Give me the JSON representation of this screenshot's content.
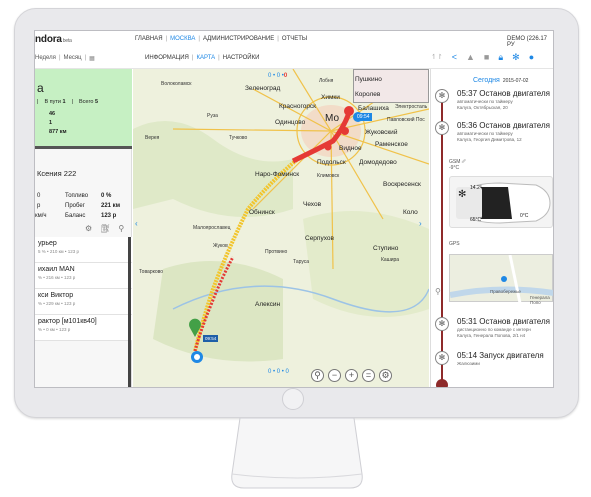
{
  "header": {
    "logo": "ndora",
    "logo_suffix": "beta",
    "nav": [
      "ГЛАВНАЯ",
      "МОСКВА",
      "АДМИНИСТРИРОВАНИЕ",
      "ОТЧЕТЫ"
    ],
    "nav_active_index": 1,
    "account": "DEMO (226.17 РУ",
    "period": [
      "Неделя",
      "Месяц"
    ],
    "subnav": [
      "ИНФОРМАЦИЯ",
      "КАРТА",
      "НАСТРОЙКИ"
    ],
    "subnav_active_index": 1
  },
  "left": {
    "big_title": "а",
    "in_way_label": "В пути",
    "in_way_value": "1",
    "total_label": "Всего",
    "total_value": "5",
    "v1": "46",
    "v2": "1",
    "v3": "877 км",
    "vehicle_name": "Ксения 222",
    "fuel_label": "Топливо",
    "fuel_value": "0 %",
    "mileage_label": "Пробег",
    "mileage_value": "221 км",
    "speed_label": "км/ч",
    "balance_label": "Баланс",
    "balance_value": "123 р",
    "speed_value": "0",
    "list": [
      {
        "name": "урьер",
        "meta": "5 % • 210 км • 123 р"
      },
      {
        "name": "ихаил MAN",
        "meta": "% • 216 км • 123 р"
      },
      {
        "name": "кси Виктор",
        "meta": "% • 229 км • 123 р"
      },
      {
        "name": "рактор [м101кв40]",
        "meta": "% • 0 км • 123 р"
      }
    ]
  },
  "map": {
    "counter": "0 • 0 •",
    "counter_red": "0",
    "counter_bottom": "0 • 0 • 0",
    "labels": {
      "zelenograd": "Зеленоград",
      "lobnya": "Лобня",
      "pushkino": "Пушкино",
      "khimki": "Химки",
      "korolev": "Королев",
      "krasnogorsk": "Красногорск",
      "balashikha": "Балашиха",
      "elektrostal": "Электросталь",
      "moskva": "Мо",
      "odintsovo": "Одинцово",
      "pavlposad": "Павловский Пос",
      "zhukovsky": "Жуковский",
      "ramenskoe": "Раменское",
      "vidnoe": "Видное",
      "podolsk": "Подольск",
      "domodedovo": "Домодедово",
      "klimovsk": "Климовск",
      "naro": "Наро-Фоминск",
      "voskresensk": "Воскресенск",
      "obninsk": "Обнинск",
      "chekhov": "Чехов",
      "serpukhov": "Серпухов",
      "stupino": "Ступино",
      "kolo": "Коло",
      "aleksin": "Алексин",
      "volokolamsk": "Волоколамск",
      "ruza": "Руза",
      "tuchkovo": "Тучково",
      "vereya": "Верея",
      "tarusa": "Таруса",
      "kashira": "Кашира",
      "protvino": "Протвино",
      "zhukov": "Жуков",
      "tovarkovo": "Товарково",
      "maloyaroslavets": "Малоярославец"
    },
    "marker_time": "09:54",
    "marker_time2": "09:54",
    "controls": [
      "pin-icon",
      "minus-icon",
      "plus-icon",
      "layers-icon",
      "settings-icon"
    ]
  },
  "right": {
    "today_label": "Сегодня",
    "today_date": "2015-07-02",
    "events": [
      {
        "time": "05:37 Останов двигателя",
        "sub1": "автоматически по таймеру",
        "sub2": "Калуга, Октябрьская, 20"
      },
      {
        "time": "05:36 Останов двигателя",
        "sub1": "автоматически по таймеру",
        "sub2": "Калуга, Георгия Димитрова, 12"
      },
      {
        "time": "05:31 Останов двигателя",
        "sub1": "дистанционно по команде с интерн",
        "sub2": "Калуга, Генерала Попова, 2/1 н4"
      },
      {
        "time": "05:14 Запуск двигателя",
        "sub1": "Жалюзими",
        "sub2": ""
      }
    ],
    "gsm_label": "GSM",
    "gsm_temp": "-9°C",
    "gps_label": "GPS",
    "car_temp1": "14.2°",
    "car_temp2": "65°C",
    "car_temp3": "0°C",
    "minimap_label": "Правобережье",
    "minimap_street": "Генерала Попо"
  },
  "colors": {
    "accent": "#1e88e5",
    "green": "#c6f0c3",
    "timeline": "#8e2a2a",
    "route_red": "#e53935",
    "route_yellow": "#f2c52c"
  }
}
